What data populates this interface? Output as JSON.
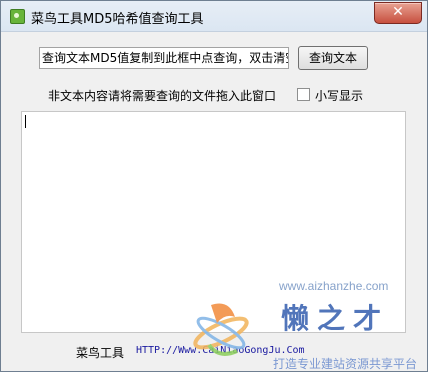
{
  "window": {
    "title": "菜鸟工具MD5哈希值查询工具",
    "close_symbol": "✕"
  },
  "main": {
    "input_value": "查询文本MD5值复制到此框中点查询，双击清空",
    "query_button_label": "查询文本",
    "drop_hint": "非文本内容请将需要查询的文件拖入此窗口",
    "lowercase_label": "小写显示",
    "lowercase_checked": false
  },
  "footer": {
    "name": "菜鸟工具",
    "url": "HTTP://Www.CaiNiaoGongJu.Com"
  },
  "watermark": {
    "url": "www.aizhanzhe.com",
    "brand": "懒之才",
    "slogan": "打造专业建站资源共享平台"
  }
}
